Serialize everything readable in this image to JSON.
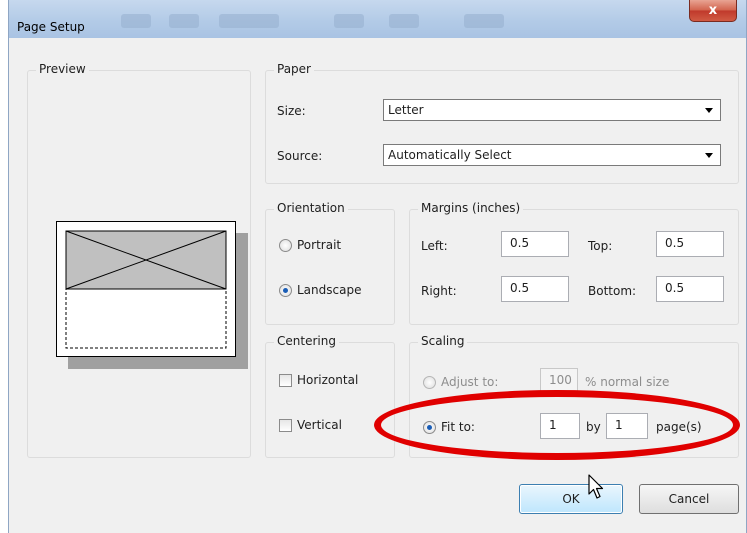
{
  "window": {
    "title": "Page Setup",
    "close_glyph": "x",
    "close_icon": "close-icon"
  },
  "preview": {
    "label": "Preview"
  },
  "paper": {
    "label": "Paper",
    "size_label": "Size:",
    "size_value": "Letter",
    "source_label": "Source:",
    "source_value": "Automatically Select"
  },
  "orientation": {
    "label": "Orientation",
    "portrait_label": "Portrait",
    "landscape_label": "Landscape",
    "selected": "Landscape"
  },
  "margins": {
    "label": "Margins (inches)",
    "left_label": "Left:",
    "left_value": "0.5",
    "top_label": "Top:",
    "top_value": "0.5",
    "right_label": "Right:",
    "right_value": "0.5",
    "bottom_label": "Bottom:",
    "bottom_value": "0.5"
  },
  "centering": {
    "label": "Centering",
    "horizontal_label": "Horizontal",
    "vertical_label": "Vertical"
  },
  "scaling": {
    "label": "Scaling",
    "adjust_label": "Adjust to:",
    "adjust_value": "100",
    "adjust_suffix": "% normal size",
    "fit_label": "Fit to:",
    "fit_wide_value": "1",
    "by_label": "by",
    "fit_tall_value": "1",
    "pages_label": "page(s)",
    "selected": "Fit to:"
  },
  "buttons": {
    "ok_label": "OK",
    "cancel_label": "Cancel"
  },
  "colors": {
    "highlight": "#e00000",
    "accent": "#1a5db6"
  }
}
